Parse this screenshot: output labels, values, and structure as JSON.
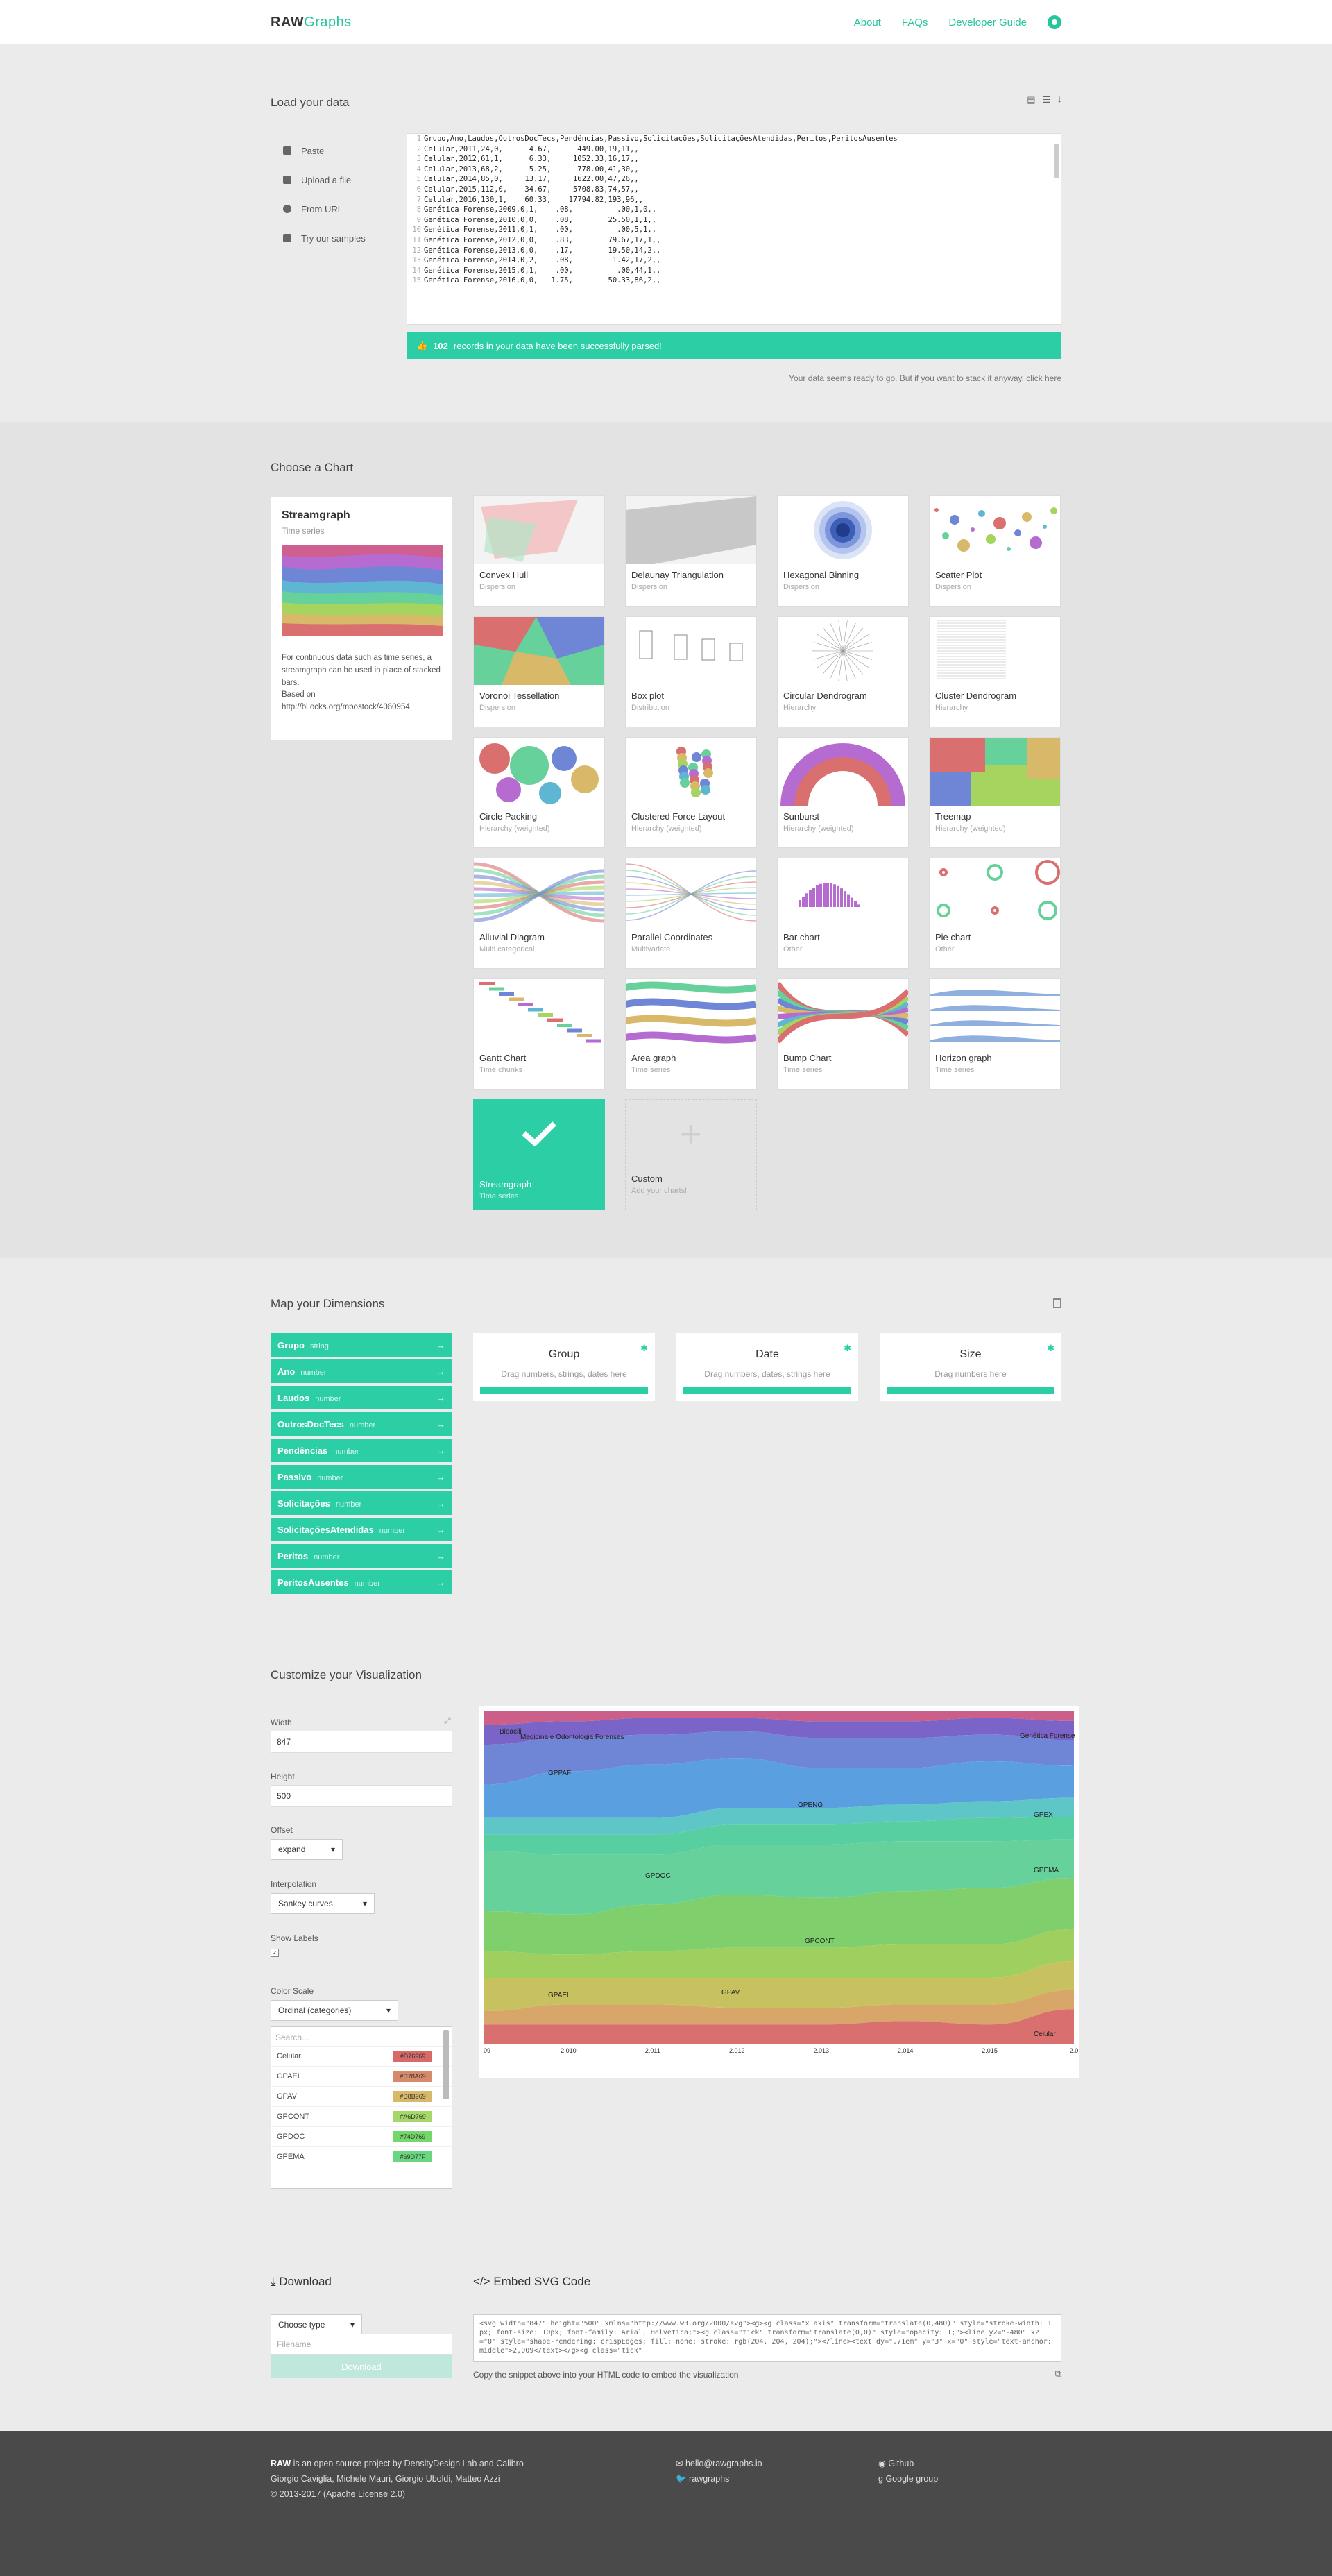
{
  "header": {
    "logo_bold": "RAW",
    "logo_light": "Graphs",
    "nav": [
      "About",
      "FAQs",
      "Developer Guide"
    ]
  },
  "load": {
    "title": "Load your data",
    "menu": [
      "Paste",
      "Upload a file",
      "From URL",
      "Try our samples"
    ],
    "lines": [
      "Grupo,Ano,Laudos,OutrosDocTecs,Pendências,Passivo,Solicitações,SolicitaçõesAtendidas,Peritos,PeritosAusentes",
      "Celular,2011,24,0,      4.67,      449.00,19,11,,",
      "Celular,2012,61,1,      6.33,     1052.33,16,17,,",
      "Celular,2013,68,2,      5.25,      778.00,41,30,,",
      "Celular,2014,85,0,     13.17,     1622.00,47,26,,",
      "Celular,2015,112,0,    34.67,     5708.83,74,57,,",
      "Celular,2016,130,1,    60.33,    17794.82,193,96,,",
      "Genética Forense,2009,0,1,    .08,          .00,1,0,,",
      "Genética Forense,2010,0,0,    .08,        25.50,1,1,,",
      "Genética Forense,2011,0,1,    .00,          .00,5,1,,",
      "Genética Forense,2012,0,0,    .83,        79.67,17,1,,",
      "Genética Forense,2013,0,0,    .17,        19.50,14,2,,",
      "Genética Forense,2014,0,2,    .08,         1.42,17,2,,",
      "Genética Forense,2015,0,1,    .00,          .00,44,1,,",
      "Genética Forense,2016,0,0,   1.75,        50.33,86,2,,"
    ],
    "parsed_count": "102",
    "parsed_text": "records in your data have been successfully parsed!",
    "stack_msg": "Your data seems ready to go. But if you want to stack it anyway, click here"
  },
  "choose": {
    "title": "Choose a Chart",
    "selected": {
      "name": "Streamgraph",
      "category": "Time series",
      "desc": "For continuous data such as time series, a streamgraph can be used in place of stacked bars.",
      "based": "Based on",
      "link": "http://bl.ocks.org/mbostock/4060954"
    },
    "charts": [
      {
        "name": "Convex Hull",
        "cat": "Dispersion"
      },
      {
        "name": "Delaunay Triangulation",
        "cat": "Dispersion"
      },
      {
        "name": "Hexagonal Binning",
        "cat": "Dispersion"
      },
      {
        "name": "Scatter Plot",
        "cat": "Dispersion"
      },
      {
        "name": "Voronoi Tessellation",
        "cat": "Dispersion"
      },
      {
        "name": "Box plot",
        "cat": "Distribution"
      },
      {
        "name": "Circular Dendrogram",
        "cat": "Hierarchy"
      },
      {
        "name": "Cluster Dendrogram",
        "cat": "Hierarchy"
      },
      {
        "name": "Circle Packing",
        "cat": "Hierarchy (weighted)"
      },
      {
        "name": "Clustered Force Layout",
        "cat": "Hierarchy (weighted)"
      },
      {
        "name": "Sunburst",
        "cat": "Hierarchy (weighted)"
      },
      {
        "name": "Treemap",
        "cat": "Hierarchy (weighted)"
      },
      {
        "name": "Alluvial Diagram",
        "cat": "Multi categorical"
      },
      {
        "name": "Parallel Coordinates",
        "cat": "Multivariate"
      },
      {
        "name": "Bar chart",
        "cat": "Other"
      },
      {
        "name": "Pie chart",
        "cat": "Other"
      },
      {
        "name": "Gantt Chart",
        "cat": "Time chunks"
      },
      {
        "name": "Area graph",
        "cat": "Time series"
      },
      {
        "name": "Bump Chart",
        "cat": "Time series"
      },
      {
        "name": "Horizon graph",
        "cat": "Time series"
      },
      {
        "name": "Streamgraph",
        "cat": "Time series"
      },
      {
        "name": "Custom",
        "cat": "Add your charts!"
      }
    ]
  },
  "map": {
    "title": "Map your Dimensions",
    "dims": [
      {
        "name": "Grupo",
        "type": "string"
      },
      {
        "name": "Ano",
        "type": "number"
      },
      {
        "name": "Laudos",
        "type": "number"
      },
      {
        "name": "OutrosDocTecs",
        "type": "number"
      },
      {
        "name": "Pendências",
        "type": "number"
      },
      {
        "name": "Passivo",
        "type": "number"
      },
      {
        "name": "Solicitações",
        "type": "number"
      },
      {
        "name": "SolicitaçõesAtendidas",
        "type": "number"
      },
      {
        "name": "Peritos",
        "type": "number"
      },
      {
        "name": "PeritosAusentes",
        "type": "number"
      }
    ],
    "slots": [
      {
        "name": "Group",
        "hint": "Drag numbers, strings, dates here"
      },
      {
        "name": "Date",
        "hint": "Drag numbers, dates, strings here"
      },
      {
        "name": "Size",
        "hint": "Drag numbers here"
      }
    ]
  },
  "customize": {
    "title": "Customize your Visualization",
    "width_label": "Width",
    "width": "847",
    "height_label": "Height",
    "height": "500",
    "offset_label": "Offset",
    "offset": "expand",
    "interp_label": "Interpolation",
    "interp": "Sankey curves",
    "labels_label": "Show Labels",
    "scale_label": "Color Scale",
    "scale": "Ordinal (categories)",
    "search": "Search...",
    "colors": [
      {
        "name": "Celular",
        "hex": "#D76969",
        "color": "#d76969"
      },
      {
        "name": "GPAEL",
        "hex": "#D78A69",
        "color": "#d78a69"
      },
      {
        "name": "GPAV",
        "hex": "#D8B969",
        "color": "#d8b969"
      },
      {
        "name": "GPCONT",
        "hex": "#A6D769",
        "color": "#a6d769"
      },
      {
        "name": "GPDOC",
        "hex": "#74D769",
        "color": "#74d769"
      },
      {
        "name": "GPEMA",
        "hex": "#69D77F",
        "color": "#69d77f"
      }
    ],
    "stream_labels": [
      "Bioacili",
      "Medicina e Odontologia Forenses",
      "GPPAF",
      "GPENG",
      "GPDOC",
      "GPEX",
      "GPEMA",
      "GPCONT",
      "GPAV",
      "GPAEL",
      "Celular",
      "Genética Forense"
    ],
    "x_ticks": [
      "09",
      "2.010",
      "2.011",
      "2.012",
      "2.013",
      "2.014",
      "2.015",
      "2.0"
    ]
  },
  "download": {
    "title": "Download",
    "type_label": "Choose type",
    "filename": "Filename",
    "button": "Download",
    "embed_title": "Embed SVG Code",
    "code": "<svg width=\"847\" height=\"500\" xmlns=\"http://www.w3.org/2000/svg\"><g><g class=\"x axis\" transform=\"translate(0,480)\" style=\"stroke-width: 1px; font-size: 10px; font-family: Arial, Helvetica;\"><g class=\"tick\" transform=\"translate(0,0)\" style=\"opacity: 1;\"><line y2=\"-480\" x2=\"0\" style=\"shape-rendering: crispEdges; fill: none; stroke: rgb(204, 204, 204);\"></line><text dy=\".71em\" y=\"3\" x=\"0\" style=\"text-anchor: middle\">2,009</text></g><g class=\"tick\"",
    "copy_note": "Copy the snippet above into your HTML code to embed the visualization"
  },
  "footer": {
    "l1a": "RAW",
    "l1b": " is an open source project by DensityDesign Lab and Calibro",
    "l2": "Giorgio Caviglia, Michele Mauri, Giorgio Uboldi, Matteo Azzi",
    "l3": "© 2013-2017 (Apache License 2.0)",
    "mail": "hello@rawgraphs.io",
    "twitter": "rawgraphs",
    "github": "Github",
    "group": "Google group"
  }
}
